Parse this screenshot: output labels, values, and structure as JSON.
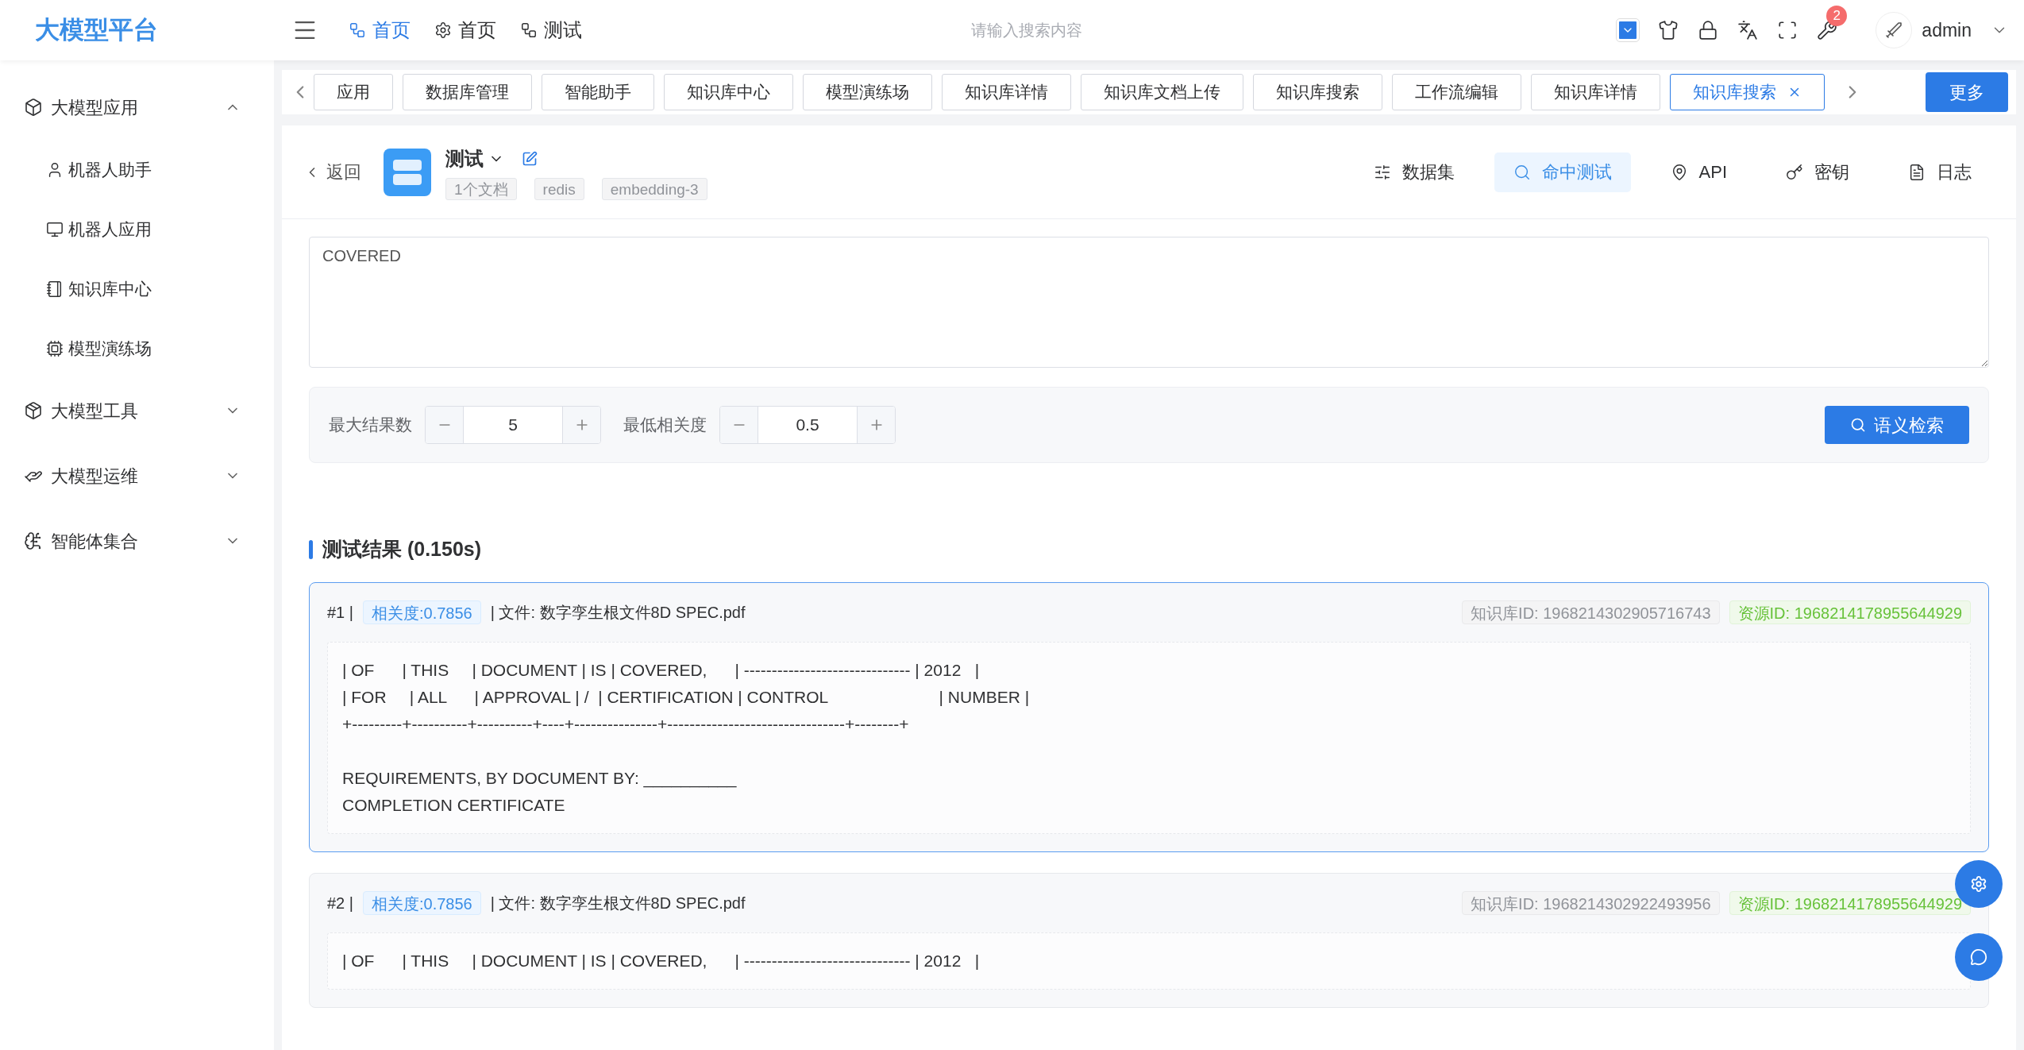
{
  "app": {
    "title": "大模型平台"
  },
  "top_nav": [
    {
      "label": "首页",
      "selected": true
    },
    {
      "label": "首页",
      "selected": false
    },
    {
      "label": "测试",
      "selected": false
    }
  ],
  "search": {
    "placeholder": "请输入搜索内容"
  },
  "notifications": {
    "count": "2"
  },
  "user": {
    "name": "admin"
  },
  "sidebar": {
    "items": [
      {
        "label": "大模型应用",
        "expanded": true,
        "children": [
          {
            "label": "机器人助手"
          },
          {
            "label": "机器人应用"
          },
          {
            "label": "知识库中心"
          },
          {
            "label": "模型演练场"
          }
        ]
      },
      {
        "label": "大模型工具",
        "expanded": false
      },
      {
        "label": "大模型运维",
        "expanded": false
      },
      {
        "label": "智能体集合",
        "expanded": false
      }
    ]
  },
  "tabs": [
    {
      "label": "应用",
      "selected": false
    },
    {
      "label": "数据库管理",
      "selected": false
    },
    {
      "label": "智能助手",
      "selected": false
    },
    {
      "label": "知识库中心",
      "selected": false
    },
    {
      "label": "模型演练场",
      "selected": false
    },
    {
      "label": "知识库详情",
      "selected": false
    },
    {
      "label": "知识库文档上传",
      "selected": false
    },
    {
      "label": "知识库搜索",
      "selected": false
    },
    {
      "label": "工作流编辑",
      "selected": false
    },
    {
      "label": "知识库详情",
      "selected": false
    },
    {
      "label": "知识库搜索",
      "selected": true
    }
  ],
  "more_button": "更多",
  "back": "返回",
  "dataset": {
    "name": "测试",
    "tags": [
      "1个文档",
      "redis",
      "embedding-3"
    ]
  },
  "view_tabs": [
    {
      "label": "数据集",
      "selected": false
    },
    {
      "label": "命中测试",
      "selected": true
    },
    {
      "label": "API",
      "selected": false
    },
    {
      "label": "密钥",
      "selected": false
    },
    {
      "label": "日志",
      "selected": false
    }
  ],
  "query": {
    "value": "COVERED"
  },
  "params": [
    {
      "label": "最大结果数",
      "value": "5"
    },
    {
      "label": "最低相关度",
      "value": "0.5"
    }
  ],
  "search_button": "语义检索",
  "results": {
    "title": "测试结果 (0.150s)",
    "items": [
      {
        "index": "#1 |",
        "score": "相关度:0.7856",
        "file": "| 文件: 数字孪生根文件8D SPEC.pdf",
        "kb_id": "知识库ID: 1968214302905716743",
        "resource_id": "资源ID: 1968214178955644929",
        "selected": true,
        "table_lines": [
          "| OF      | THIS     | DOCUMENT | IS | COVERED,      | ------------------------------ | 2012   |",
          "| FOR     | ALL      | APPROVAL | /  | CERTIFICATION | CONTROL                        | NUMBER |",
          "+---------+----------+----------+----+---------------+--------------------------------+--------+"
        ],
        "text_lines": [
          "REQUIREMENTS, BY DOCUMENT BY: __________",
          "COMPLETION CERTIFICATE"
        ]
      },
      {
        "index": "#2 |",
        "score": "相关度:0.7856",
        "file": "| 文件: 数字孪生根文件8D SPEC.pdf",
        "kb_id": "知识库ID: 1968214302922493956",
        "resource_id": "资源ID: 1968214178955644929",
        "selected": false,
        "table_lines": [
          "| OF      | THIS     | DOCUMENT | IS | COVERED,      | ------------------------------ | 2012   |"
        ]
      }
    ]
  }
}
